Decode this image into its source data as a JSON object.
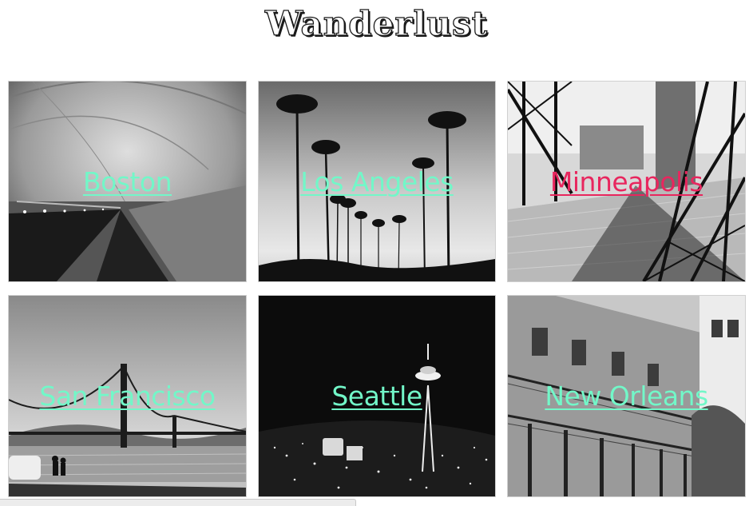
{
  "site": {
    "title": "Wanderlust"
  },
  "colors": {
    "link": "#72f7c8",
    "link_hover": "#e8265e"
  },
  "cities": [
    {
      "name": "Boston",
      "photo_icon": "tunnel-photo"
    },
    {
      "name": "Los Angeles",
      "photo_icon": "palm-trees-photo"
    },
    {
      "name": "Minneapolis",
      "photo_icon": "bridge-photo",
      "hovered": true
    },
    {
      "name": "San Francisco",
      "photo_icon": "golden-gate-photo"
    },
    {
      "name": "Seattle",
      "photo_icon": "space-needle-photo"
    },
    {
      "name": "New Orleans",
      "photo_icon": "french-quarter-photo"
    }
  ]
}
